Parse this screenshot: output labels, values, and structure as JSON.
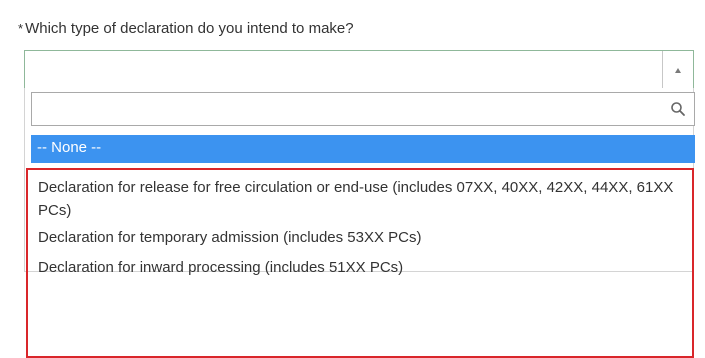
{
  "question": {
    "required_marker": "*",
    "label": "Which type of declaration do you intend to make?"
  },
  "select": {
    "current_value": "",
    "state": "open"
  },
  "search": {
    "placeholder": "",
    "value": ""
  },
  "options": [
    {
      "label": "-- None --",
      "selected": true
    },
    {
      "label": "Declaration for release for free circulation or end-use (includes 07XX, 40XX, 42XX, 44XX, 61XX PCs)",
      "selected": false
    },
    {
      "label": "Declaration for temporary admission (includes 53XX PCs)",
      "selected": false
    },
    {
      "label": "Declaration for inward processing (includes 51XX PCs)",
      "selected": false
    }
  ],
  "colors": {
    "selected_option_bg": "#3c93f0",
    "highlight_border": "#d9262a",
    "select_border": "#8fb89a"
  },
  "icons": {
    "search": "search-icon",
    "caret": "caret-up-icon"
  }
}
